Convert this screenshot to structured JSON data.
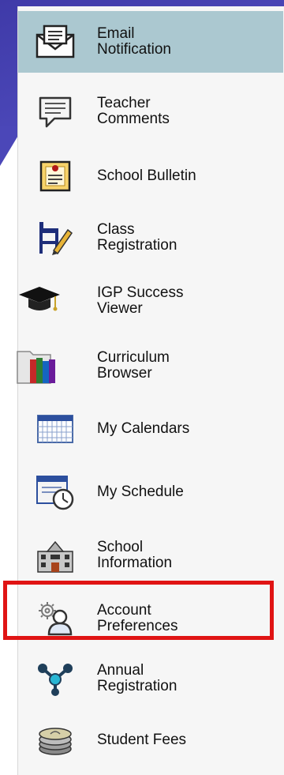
{
  "menu": {
    "items": [
      {
        "label": "Email\nNotification",
        "icon": "envelope-icon",
        "active": true
      },
      {
        "label": "Teacher\nComments",
        "icon": "speech-bubble-icon"
      },
      {
        "label": "School Bulletin",
        "icon": "bulletin-icon"
      },
      {
        "label": "Class\nRegistration",
        "icon": "desk-pencil-icon"
      },
      {
        "label": "IGP Success\nViewer",
        "icon": "graduation-cap-icon"
      },
      {
        "label": "Curriculum\nBrowser",
        "icon": "folder-books-icon"
      },
      {
        "label": "My Calendars",
        "icon": "calendar-grid-icon"
      },
      {
        "label": "My Schedule",
        "icon": "schedule-clock-icon"
      },
      {
        "label": "School\nInformation",
        "icon": "school-building-icon"
      },
      {
        "label": "Account\nPreferences",
        "icon": "user-gear-icon",
        "highlighted": true
      },
      {
        "label": "Annual\nRegistration",
        "icon": "network-nodes-icon"
      },
      {
        "label": "Student Fees",
        "icon": "coin-stack-icon"
      }
    ]
  },
  "colors": {
    "active_bg": "#abc8d0",
    "highlight_border": "#e01414",
    "slide_blue": "#4b47b8"
  }
}
